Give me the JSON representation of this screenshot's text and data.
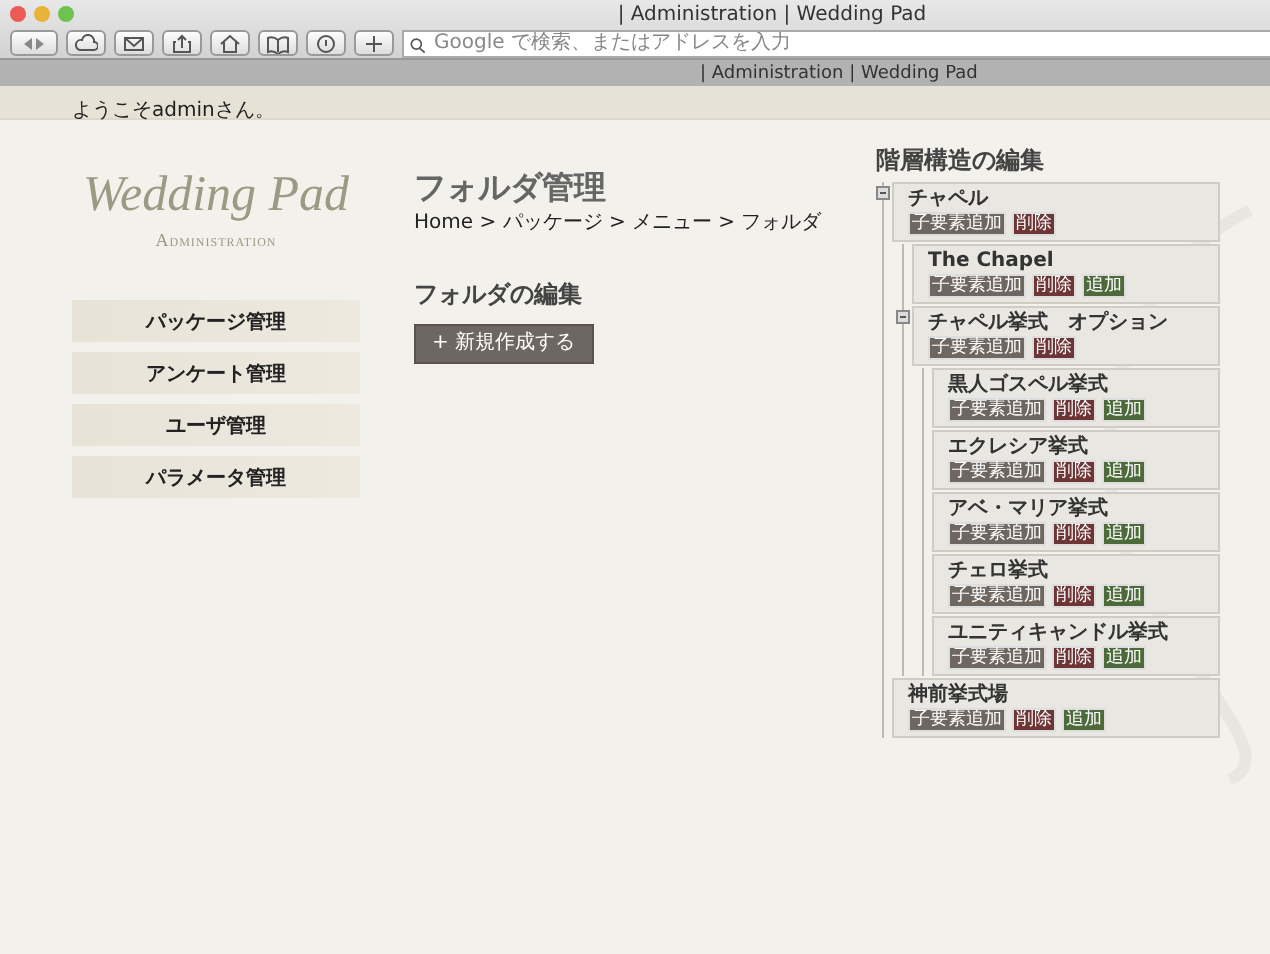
{
  "browser": {
    "title": "| Administration | Wedding Pad",
    "address_placeholder": "Google で検索、またはアドレスを入力",
    "tab_title": "| Administration | Wedding Pad"
  },
  "welcome": "ようこそadminさん。",
  "logo": {
    "name": "Wedding Pad",
    "subtitle": "Administration"
  },
  "nav": [
    "パッケージ管理",
    "アンケート管理",
    "ユーザ管理",
    "パラメータ管理"
  ],
  "page": {
    "title": "フォルダ管理",
    "breadcrumb": "Home > パッケージ > メニュー > フォルダ"
  },
  "folder_edit": {
    "heading": "フォルダの編集",
    "new_button": "+ 新規作成する"
  },
  "tree": {
    "heading": "階層構造の編集",
    "nodes": [
      {
        "label": "チャペル",
        "expanded": true,
        "actions": [
          {
            "label": "子要素追加",
            "kind": "add-child"
          },
          {
            "label": "削除",
            "kind": "delete"
          }
        ],
        "children": [
          {
            "label": "The Chapel",
            "actions": [
              {
                "label": "子要素追加",
                "kind": "add-child"
              },
              {
                "label": "削除",
                "kind": "delete"
              },
              {
                "label": "追加",
                "kind": "add"
              }
            ]
          },
          {
            "label": "チャペル挙式　オプション",
            "expanded": true,
            "actions": [
              {
                "label": "子要素追加",
                "kind": "add-child"
              },
              {
                "label": "削除",
                "kind": "delete"
              }
            ],
            "children": [
              {
                "label": "黒人ゴスペル挙式",
                "actions": [
                  {
                    "label": "子要素追加",
                    "kind": "add-child"
                  },
                  {
                    "label": "削除",
                    "kind": "delete"
                  },
                  {
                    "label": "追加",
                    "kind": "add"
                  }
                ]
              },
              {
                "label": "エクレシア挙式",
                "actions": [
                  {
                    "label": "子要素追加",
                    "kind": "add-child"
                  },
                  {
                    "label": "削除",
                    "kind": "delete"
                  },
                  {
                    "label": "追加",
                    "kind": "add"
                  }
                ]
              },
              {
                "label": "アベ・マリア挙式",
                "actions": [
                  {
                    "label": "子要素追加",
                    "kind": "add-child"
                  },
                  {
                    "label": "削除",
                    "kind": "delete"
                  },
                  {
                    "label": "追加",
                    "kind": "add"
                  }
                ]
              },
              {
                "label": "チェロ挙式",
                "actions": [
                  {
                    "label": "子要素追加",
                    "kind": "add-child"
                  },
                  {
                    "label": "削除",
                    "kind": "delete"
                  },
                  {
                    "label": "追加",
                    "kind": "add"
                  }
                ]
              },
              {
                "label": "ユニティキャンドル挙式",
                "actions": [
                  {
                    "label": "子要素追加",
                    "kind": "add-child"
                  },
                  {
                    "label": "削除",
                    "kind": "delete"
                  },
                  {
                    "label": "追加",
                    "kind": "add"
                  }
                ]
              }
            ]
          }
        ]
      },
      {
        "label": "神前挙式場",
        "actions": [
          {
            "label": "子要素追加",
            "kind": "add-child"
          },
          {
            "label": "削除",
            "kind": "delete"
          },
          {
            "label": "追加",
            "kind": "add"
          }
        ]
      }
    ]
  }
}
